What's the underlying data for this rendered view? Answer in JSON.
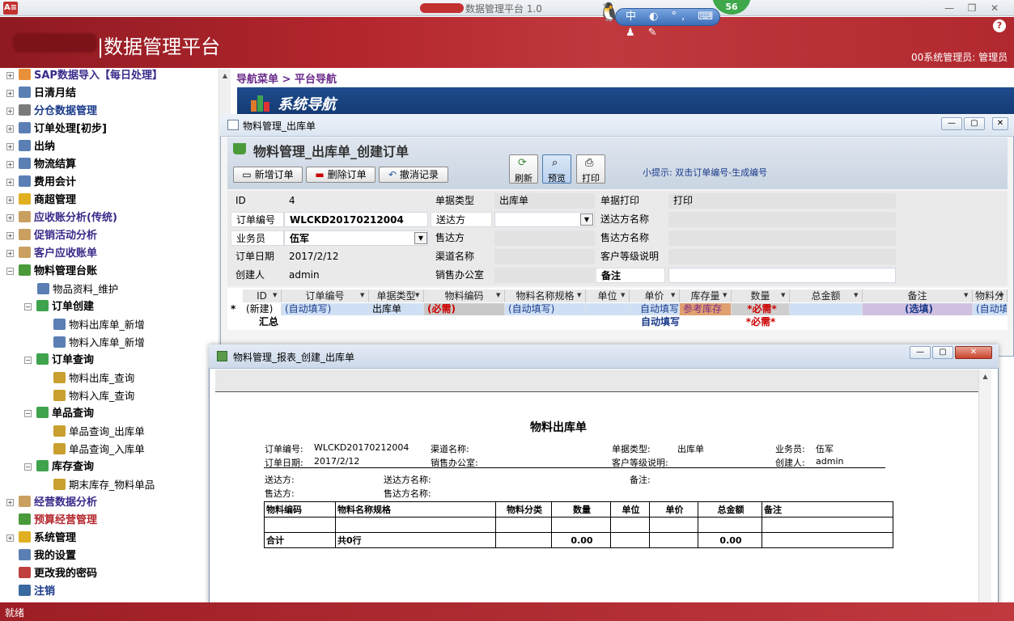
{
  "window": {
    "title": "数据管理平台 1.0",
    "minimize": "—",
    "restore": "❐",
    "close": "✕"
  },
  "ime": {
    "text": "中 ◐ °, ⌨ ♟ ✎",
    "badge": "56"
  },
  "banner": {
    "title": "|数据管理平台",
    "user": "00系统管理员: 管理员",
    "help": "?"
  },
  "sidebar": {
    "items": [
      {
        "label": "SAP数据导入【每日处理】",
        "icon": "rss-icon",
        "color": "#e8913a"
      },
      {
        "label": "日清月结",
        "icon": "book-icon",
        "color": "#5b7fb5"
      },
      {
        "label": "分仓数据管理",
        "icon": "tools-icon",
        "color": "#7a7a7a"
      },
      {
        "label": "订单处理[初步]",
        "icon": "book-icon",
        "color": "#5b7fb5"
      },
      {
        "label": "出纳",
        "icon": "book-icon",
        "color": "#5b7fb5"
      },
      {
        "label": "物流结算",
        "icon": "book-icon",
        "color": "#5b7fb5"
      },
      {
        "label": "费用会计",
        "icon": "book-icon",
        "color": "#5b7fb5"
      },
      {
        "label": "商超管理",
        "icon": "store-icon",
        "color": "#e0b020"
      },
      {
        "label": "应收账分析(传统)",
        "icon": "scroll-icon",
        "color": "#c9a060"
      },
      {
        "label": "促销活动分析",
        "icon": "scroll-icon",
        "color": "#c9a060"
      },
      {
        "label": "客户应收账单",
        "icon": "scroll-icon",
        "color": "#c9a060"
      },
      {
        "label": "物料管理台账",
        "icon": "basket-icon",
        "color": "#4a9a3a"
      }
    ],
    "sub": [
      {
        "label": "物品资料_维护",
        "icon": "edit-doc-icon"
      },
      {
        "label": "订单创建",
        "icon": "arrow-icon"
      },
      {
        "label": "物料出库单_新增",
        "icon": "edit-doc-icon"
      },
      {
        "label": "物料入库单_新增",
        "icon": "edit-doc-icon"
      },
      {
        "label": "订单查询",
        "icon": "arrow-icon"
      },
      {
        "label": "物料出库_查询",
        "icon": "chart-icon"
      },
      {
        "label": "物料入库_查询",
        "icon": "chart-icon"
      },
      {
        "label": "单品查询",
        "icon": "arrow-icon"
      },
      {
        "label": "单品查询_出库单",
        "icon": "chart-icon"
      },
      {
        "label": "单品查询_入库单",
        "icon": "chart-icon"
      },
      {
        "label": "库存查询",
        "icon": "arrow-icon"
      },
      {
        "label": "期末库存_物料单品",
        "icon": "chart-icon"
      }
    ],
    "tail": [
      {
        "label": "经营数据分析",
        "icon": "scroll-icon"
      },
      {
        "label": "预算经营管理",
        "icon": "gem-icon"
      },
      {
        "label": "系统管理",
        "icon": "star-icon"
      },
      {
        "label": "我的设置",
        "icon": "gear-icon"
      },
      {
        "label": "更改我的密码",
        "icon": "user-key-icon"
      },
      {
        "label": "注销",
        "icon": "door-icon"
      }
    ]
  },
  "main": {
    "breadcrumb": "导航菜单 > 平台导航",
    "nav_title": "系统导航"
  },
  "order_window": {
    "title": "物料管理_出库单",
    "heading": "物料管理_出库单_创建订单",
    "buttons": {
      "new": "新增订单",
      "delete": "删除订单",
      "undo": "撤消记录",
      "refresh": "刷新",
      "preview": "预览",
      "print": "打印"
    },
    "tip": "小提示: 双击订单编号-生成编号",
    "fields": {
      "id_label": "ID",
      "id_value": "4",
      "doc_type_label": "单据类型",
      "doc_type_value": "出库单",
      "doc_print_label": "单据打印",
      "doc_print_value": "打印",
      "order_no_label": "订单编号",
      "order_no_value": "WLCKD20170212004",
      "ship_to_label": "送达方",
      "ship_to_value": "",
      "ship_to_name_label": "送达方名称",
      "staff_label": "业务员",
      "staff_value": "伍军",
      "sold_to_label": "售达方",
      "sold_to_name_label": "售达方名称",
      "date_label": "订单日期",
      "date_value": "2017/2/12",
      "channel_label": "渠道名称",
      "customer_level_label": "客户等级说明",
      "creator_label": "创建人",
      "creator_value": "admin",
      "sales_office_label": "销售办公室",
      "remark_label": "备注",
      "remark_value": ""
    },
    "grid": {
      "headers": [
        "ID",
        "订单编号",
        "单据类型",
        "物料编码",
        "物料名称规格",
        "单位",
        "单价",
        "库存量",
        "数量",
        "总金额",
        "备注",
        "物料分"
      ],
      "new_row": [
        "(新建)",
        "(自动填写)",
        "出库单",
        "(必需)",
        "(自动填写)",
        "",
        "自动填写",
        "参考库存",
        "*必需*",
        "",
        "(选填)",
        "(自动填"
      ],
      "total_row": {
        "label": "汇总",
        "price": "自动填写",
        "qty": "*必需*"
      },
      "row_marker": "*"
    }
  },
  "report_window": {
    "title": "物料管理_报表_创建_出库单",
    "report_title": "物料出库单",
    "header": {
      "order_no_label": "订单编号:",
      "order_no": "WLCKD20170212004",
      "channel_label": "渠道名称:",
      "doc_type_label": "单据类型:",
      "doc_type": "出库单",
      "staff_label": "业务员:",
      "staff": "伍军",
      "date_label": "订单日期:",
      "date": "2017/2/12",
      "office_label": "销售办公室:",
      "cust_level_label": "客户等级说明:",
      "creator_label": "创建人:",
      "creator": "admin",
      "ship_to_label": "送达方:",
      "ship_to_name_label": "送达方名称:",
      "remark_label": "备注:",
      "sold_to_label": "售达方:",
      "sold_to_name_label": "售达方名称:"
    },
    "table": {
      "headers": [
        "物料编码",
        "物料名称规格",
        "物料分类",
        "数量",
        "单位",
        "单价",
        "总金额",
        "备注"
      ],
      "total_label": "合计",
      "row_count": "共0行",
      "qty_total": "0.00",
      "amount_total": "0.00"
    }
  },
  "status": {
    "text": "就绪"
  }
}
